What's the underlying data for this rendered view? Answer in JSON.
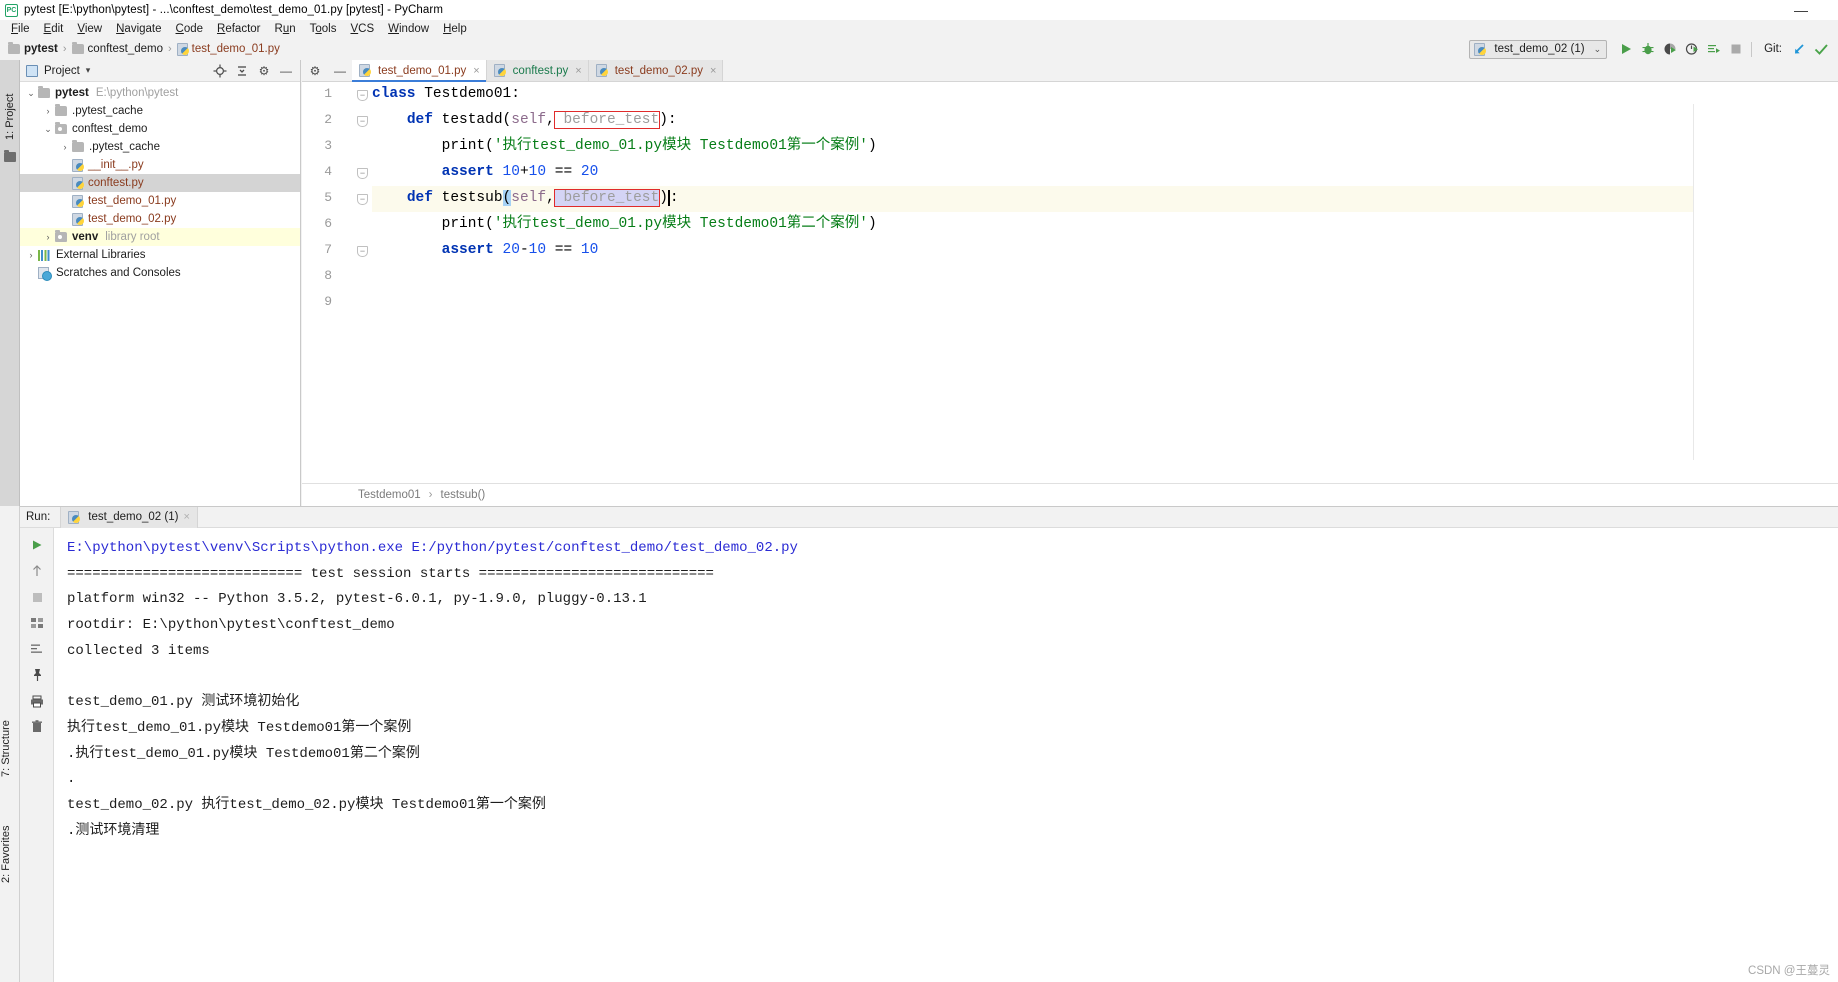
{
  "window": {
    "title": "pytest [E:\\python\\pytest] - ...\\conftest_demo\\test_demo_01.py [pytest] - PyCharm",
    "logo_text": "PC",
    "minimize_glyph": "—"
  },
  "menubar": {
    "items": [
      "File",
      "Edit",
      "View",
      "Navigate",
      "Code",
      "Refactor",
      "Run",
      "Tools",
      "VCS",
      "Window",
      "Help"
    ]
  },
  "breadcrumb": {
    "items": [
      {
        "label": "pytest",
        "kind": "folder-bold"
      },
      {
        "label": "conftest_demo",
        "kind": "folder"
      },
      {
        "label": "test_demo_01.py",
        "kind": "python"
      }
    ],
    "separator": "›"
  },
  "toolbar": {
    "run_config_label": "test_demo_02 (1)",
    "run_config_chevron": "⌄",
    "git_label": "Git:",
    "buttons": [
      "run",
      "debug",
      "run-coverage",
      "profile",
      "run-with-console",
      "stop"
    ],
    "git_buttons": [
      "update-project",
      "commit-checkmark"
    ]
  },
  "left_strip": {
    "project_tab": "1: Project",
    "structure_tab": "7: Structure",
    "favorites_tab": "2: Favorites"
  },
  "project_panel": {
    "header_title": "Project",
    "header_chevron": "▾",
    "tree": [
      {
        "label": "pytest",
        "sub": "E:\\python\\pytest",
        "depth": 0,
        "arrow": "⌄",
        "icon": "folder",
        "style": "bold",
        "state": "normal"
      },
      {
        "label": ".pytest_cache",
        "sub": "",
        "depth": 1,
        "arrow": "›",
        "icon": "folder",
        "style": "normal",
        "state": "normal"
      },
      {
        "label": "conftest_demo",
        "sub": "",
        "depth": 1,
        "arrow": "⌄",
        "icon": "folder-src",
        "style": "normal",
        "state": "normal"
      },
      {
        "label": ".pytest_cache",
        "sub": "",
        "depth": 2,
        "arrow": "›",
        "icon": "folder",
        "style": "normal",
        "state": "normal"
      },
      {
        "label": "__init__.py",
        "sub": "",
        "depth": 2,
        "arrow": "",
        "icon": "python",
        "style": "py",
        "state": "normal"
      },
      {
        "label": "conftest.py",
        "sub": "",
        "depth": 2,
        "arrow": "",
        "icon": "python",
        "style": "py",
        "state": "selected"
      },
      {
        "label": "test_demo_01.py",
        "sub": "",
        "depth": 2,
        "arrow": "",
        "icon": "python",
        "style": "py",
        "state": "normal"
      },
      {
        "label": "test_demo_02.py",
        "sub": "",
        "depth": 2,
        "arrow": "",
        "icon": "python",
        "style": "py",
        "state": "normal"
      },
      {
        "label": "venv",
        "sub": "library root",
        "depth": 1,
        "arrow": "›",
        "icon": "folder-src",
        "style": "bold",
        "state": "highlight"
      },
      {
        "label": "External Libraries",
        "sub": "",
        "depth": 0,
        "arrow": "›",
        "icon": "libraries",
        "style": "normal",
        "state": "normal"
      },
      {
        "label": "Scratches and Consoles",
        "sub": "",
        "depth": 0,
        "arrow": "",
        "icon": "scratches",
        "style": "normal",
        "state": "normal"
      }
    ]
  },
  "editor": {
    "tabs": [
      {
        "label": "test_demo_01.py",
        "active": true,
        "color": "brown"
      },
      {
        "label": "conftest.py",
        "active": false,
        "color": "green"
      },
      {
        "label": "test_demo_02.py",
        "active": false,
        "color": "brown"
      }
    ],
    "close_glyph": "×",
    "line_numbers": [
      "1",
      "2",
      "3",
      "4",
      "5",
      "6",
      "7",
      "8",
      "9"
    ],
    "code_lines": [
      "class Testdemo01:",
      "    def testadd(self, before_test):",
      "        print('执行test_demo_01.py模块 Testdemo01第一个案例')",
      "        assert 10+10 == 20",
      "    def testsub(self, before_test):",
      "        print('执行test_demo_01.py模块 Testdemo01第二个案例')",
      "        assert 20-10 == 10",
      "",
      ""
    ],
    "breadcrumb": {
      "class_name": "Testdemo01",
      "separator": "›",
      "method_name": "testsub()"
    }
  },
  "run_panel": {
    "label": "Run:",
    "tab_label": "test_demo_02 (1)",
    "close_glyph": "×",
    "tool_icons": [
      "run-green",
      "scroll-up",
      "stop-grey",
      "test-tree",
      "sort",
      "pin",
      "print",
      "trash"
    ],
    "console_lines": [
      {
        "text": "E:\\python\\pytest\\venv\\Scripts\\python.exe E:/python/pytest/conftest_demo/test_demo_02.py",
        "style": "cmd"
      },
      {
        "text": "============================ test session starts ============================",
        "style": "normal"
      },
      {
        "text": "platform win32 -- Python 3.5.2, pytest-6.0.1, py-1.9.0, pluggy-0.13.1",
        "style": "normal"
      },
      {
        "text": "rootdir: E:\\python\\pytest\\conftest_demo",
        "style": "normal"
      },
      {
        "text": "collected 3 items",
        "style": "normal"
      },
      {
        "text": "",
        "style": "normal"
      },
      {
        "text": "test_demo_01.py 测试环境初始化",
        "style": "normal"
      },
      {
        "text": "执行test_demo_01.py模块 Testdemo01第一个案例",
        "style": "normal"
      },
      {
        "text": ".执行test_demo_01.py模块 Testdemo01第二个案例",
        "style": "normal"
      },
      {
        "text": ".",
        "style": "normal"
      },
      {
        "text": "test_demo_02.py 执行test_demo_02.py模块 Testdemo01第一个案例",
        "style": "normal"
      },
      {
        "text": ".测试环境清理",
        "style": "normal"
      }
    ]
  },
  "watermark": "CSDN @王蔓灵",
  "colors": {
    "accent_blue": "#2b2bd4",
    "keyword_blue": "#0033b3",
    "string_green": "#067d17",
    "number_blue": "#1750eb",
    "error_red": "#e02b2b",
    "selection_lavender": "#d4d4f5",
    "highlight_yellow": "#fcfaec",
    "run_green": "#4a9e4a"
  }
}
